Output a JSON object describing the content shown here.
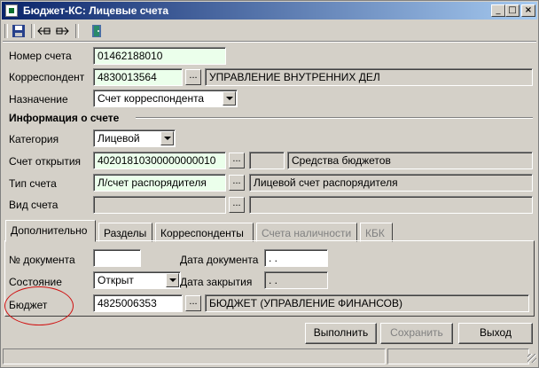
{
  "window": {
    "title": "Бюджет-КС: Лицевые счета",
    "controls": [
      "_",
      "□",
      "×"
    ]
  },
  "toolbar": {
    "tools": [
      "save-icon",
      "move-left-icon",
      "move-right-icon",
      "exit-door-icon"
    ]
  },
  "fields": {
    "account_number": {
      "label": "Номер счета",
      "value": "01462188010"
    },
    "correspondent": {
      "label": "Корреспондент",
      "value": "4830013564",
      "name": "УПРАВЛЕНИЕ ВНУТРЕННИХ ДЕЛ"
    },
    "purpose": {
      "label": "Назначение",
      "value": "Счет корреспондента"
    }
  },
  "account_info": {
    "heading": "Информация о счете",
    "category": {
      "label": "Категория",
      "value": "Лицевой"
    },
    "opening_account": {
      "label": "Счет открытия",
      "value": "40201810300000000010",
      "code": "",
      "name": "Средства бюджетов"
    },
    "account_type": {
      "label": "Тип счета",
      "value": "Л/счет распорядителя",
      "name": "Лицевой счет распорядителя"
    },
    "account_kind": {
      "label": "Вид счета",
      "value": "",
      "name": ""
    }
  },
  "tabs": [
    {
      "label": "Дополнительно",
      "active": true,
      "enabled": true
    },
    {
      "label": "Разделы",
      "active": false,
      "enabled": true
    },
    {
      "label": "Корреспонденты",
      "active": false,
      "enabled": true
    },
    {
      "label": "Счета наличности",
      "active": false,
      "enabled": false
    },
    {
      "label": "КБК",
      "active": false,
      "enabled": false
    }
  ],
  "additional": {
    "doc_number": {
      "label": "№ документа",
      "value": ""
    },
    "doc_date": {
      "label": "Дата документа",
      "value": " . ."
    },
    "state": {
      "label": "Состояние",
      "value": "Открыт"
    },
    "close_date": {
      "label": "Дата закрытия",
      "value": " . ."
    },
    "budget": {
      "label": "Бюджет",
      "value": "4825006353",
      "name": "БЮДЖЕТ (УПРАВЛЕНИЕ ФИНАНСОВ)"
    }
  },
  "buttons": {
    "execute": "Выполнить",
    "save": "Сохранить",
    "exit": "Выход"
  },
  "dots_label": "...",
  "colors": {
    "title_start": "#0a246a",
    "title_end": "#a6caf0",
    "input_green": "#ebffeb",
    "annotation_red": "#d01010"
  }
}
